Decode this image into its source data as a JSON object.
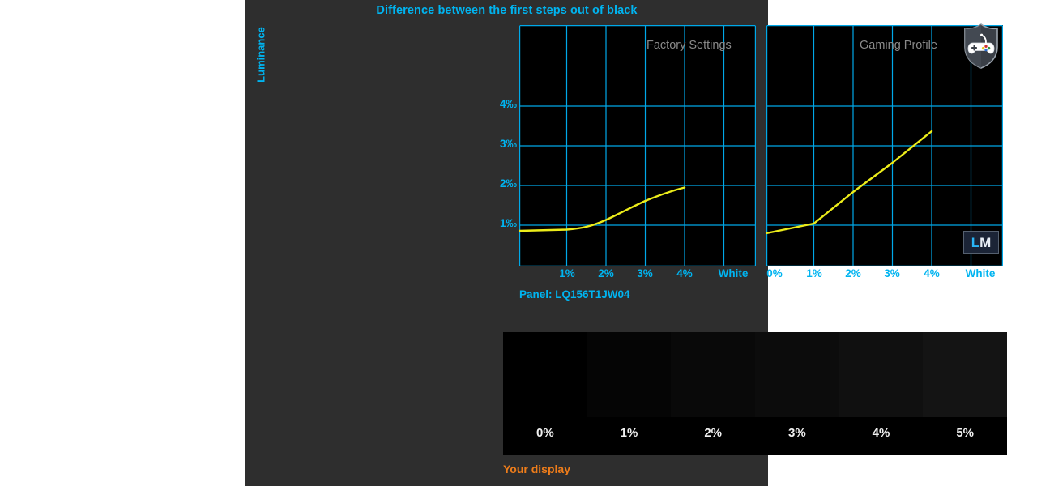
{
  "title": "Difference between the first steps out of black",
  "y_axis_title": "Luminance",
  "panel_name": "Panel: LQ156T1JW04",
  "footer_label": "Your display",
  "logo": {
    "left": "L",
    "right": "M"
  },
  "badges": {
    "gaming_shield": "shield-gamepad-icon",
    "watermark": "lm-watermark"
  },
  "colors": {
    "page_background": "#ffffff",
    "panel_background": "#2e2e2e",
    "plot_background": "#000000",
    "grid": "#00a8e8",
    "accent_cyan": "#00b4f0",
    "curve_yellow": "#ecec1a",
    "profile_label_gray": "#8a8a8a",
    "footer_orange": "#ef7d1a"
  },
  "chart_data": {
    "type": "line",
    "title": "Difference between the first steps out of black",
    "xlabel": "",
    "ylabel": "Luminance",
    "ylim": [
      0,
      5
    ],
    "ytick_labels": [
      "1‰",
      "2‰",
      "3‰",
      "4‰"
    ],
    "ytick_values": [
      1,
      2,
      3,
      4
    ],
    "grid": true,
    "legend": "none",
    "panels": [
      {
        "name": "Factory Settings",
        "categories": [
          "0%",
          "1%",
          "2%",
          "3%",
          "4%",
          "White"
        ],
        "xtick_labels": [
          "1%",
          "2%",
          "3%",
          "4%",
          "White"
        ],
        "series": [
          {
            "name": "Factory Settings",
            "color": "#ecec1a",
            "x": [
              "0%",
              "1%",
              "2%",
              "3%",
              "4%"
            ],
            "values": [
              0.85,
              0.86,
              1.0,
              1.2,
              1.43
            ]
          }
        ]
      },
      {
        "name": "Gaming Profile",
        "categories": [
          "0%",
          "1%",
          "2%",
          "3%",
          "4%",
          "White"
        ],
        "xtick_labels": [
          "0%",
          "1%",
          "2%",
          "3%",
          "4%",
          "White"
        ],
        "series": [
          {
            "name": "Gaming Profile",
            "color": "#ecec1a",
            "x": [
              "0%",
              "1%",
              "2%",
              "3%",
              "4%"
            ],
            "values": [
              0.8,
              1.05,
              1.85,
              2.6,
              3.4
            ]
          }
        ]
      }
    ]
  },
  "gradient_strip": {
    "swatches": [
      {
        "label": "0%",
        "color": "#000000"
      },
      {
        "label": "1%",
        "color": "#050505"
      },
      {
        "label": "2%",
        "color": "#090909"
      },
      {
        "label": "3%",
        "color": "#0c0c0c"
      },
      {
        "label": "4%",
        "color": "#101010"
      },
      {
        "label": "5%",
        "color": "#141414"
      }
    ]
  }
}
